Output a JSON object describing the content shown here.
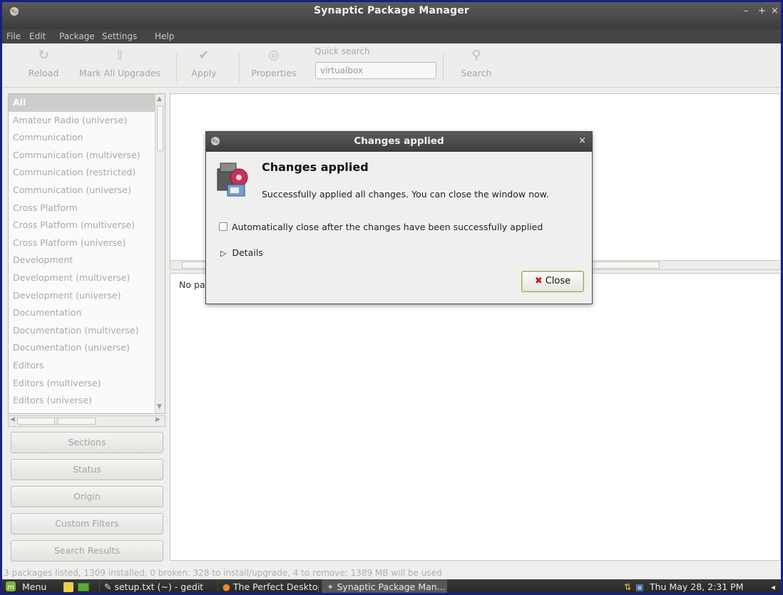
{
  "window": {
    "title": "Synaptic Package Manager"
  },
  "menubar": {
    "items": [
      "File",
      "Edit",
      "Package",
      "Settings",
      "Help"
    ]
  },
  "toolbar": {
    "reload": "Reload",
    "mark_all": "Mark All Upgrades",
    "apply": "Apply",
    "properties": "Properties",
    "quick_search_label": "Quick search",
    "quick_search_value": "virtualbox",
    "search": "Search"
  },
  "sidebar": {
    "categories": [
      "All",
      "Amateur Radio (universe)",
      "Communication",
      "Communication (multiverse)",
      "Communication (restricted)",
      "Communication (universe)",
      "Cross Platform",
      "Cross Platform (multiverse)",
      "Cross Platform (universe)",
      "Development",
      "Development (multiverse)",
      "Development (universe)",
      "Documentation",
      "Documentation (multiverse)",
      "Documentation (universe)",
      "Editors",
      "Editors (multiverse)",
      "Editors (universe)"
    ],
    "selected": "All",
    "filter_buttons": [
      "Sections",
      "Status",
      "Origin",
      "Custom Filters",
      "Search Results"
    ]
  },
  "main": {
    "description_text": "No pa"
  },
  "dialog": {
    "title": "Changes applied",
    "heading": "Changes applied",
    "message": "Successfully applied all changes. You can close the window now.",
    "auto_close_label": "Automatically close after the changes have been successfully applied",
    "auto_close_checked": false,
    "details_label": "Details",
    "close_label": "Close"
  },
  "statusbar": {
    "text": "3 packages listed, 1309 installed, 0 broken. 328 to install/upgrade, 4 to remove; 1389 MB will be used"
  },
  "taskbar": {
    "menu_label": "Menu",
    "tasks": [
      "setup.txt (~) - gedit",
      "The Perfect Desktop - ...",
      "Synaptic Package Man..."
    ],
    "clock": "Thu May 28,  2:31 PM"
  },
  "colors": {
    "title_bar": "#3c3c3c",
    "frame_border": "#1b1f82",
    "close_icon": "#cc1a1a",
    "close_button_border": "#8fae62"
  }
}
